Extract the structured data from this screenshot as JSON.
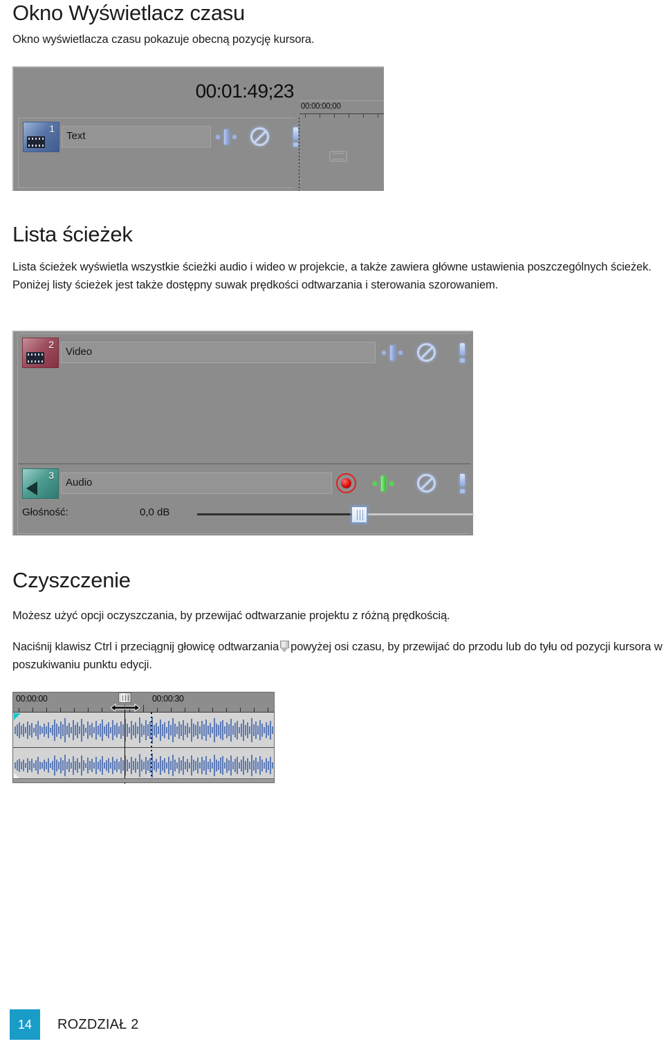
{
  "sections": {
    "time_display": {
      "heading": "Okno Wyświetlacz czasu",
      "intro": "Okno wyświetlacza czasu pokazuje obecną pozycję kursora."
    },
    "track_list": {
      "heading": "Lista ścieżek",
      "intro": "Lista ścieżek wyświetla wszystkie ścieżki audio i wideo w projekcie, a także zawiera główne ustawienia poszczególnych ścieżek. Poniżej listy ścieżek jest także dostępny suwak prędkości odtwarzania i sterowania szorowaniem."
    },
    "scrubbing": {
      "heading": "Czyszczenie",
      "paragraph1": "Możesz użyć opcji oczyszczania, by przewijać odtwarzanie projektu z różną prędkością.",
      "paragraph2_before": "Naciśnij klawisz Ctrl i przeciągnij głowicę odtwarzania",
      "paragraph2_after": "powyżej osi czasu, by przewijać do przodu lub do tyłu od pozycji kursora w poszukiwaniu punktu edycji."
    }
  },
  "screenshot_time_display": {
    "timecode": "00:01:49;23",
    "ruler_timecode": "00:00:00;00",
    "track": {
      "number": "1",
      "name": "Text"
    }
  },
  "screenshot_track_list": {
    "video_track": {
      "number": "2",
      "name": "Video"
    },
    "audio_track": {
      "number": "3",
      "name": "Audio"
    },
    "volume": {
      "label": "Głośność:",
      "value": "0,0 dB"
    }
  },
  "screenshot_waveform": {
    "ruler_start": "00:00:00",
    "ruler_mid": "00:00:30"
  },
  "footer": {
    "page_number": "14",
    "chapter": "ROZDZIAŁ 2"
  },
  "colors": {
    "accent": "#1a9cc9",
    "waveform": "#5b79b4",
    "chrome_grey": "#8c8c8c",
    "record_red": "#d50d0d",
    "pan_green": "#25c425",
    "pan_blue": "#7d96cd"
  }
}
